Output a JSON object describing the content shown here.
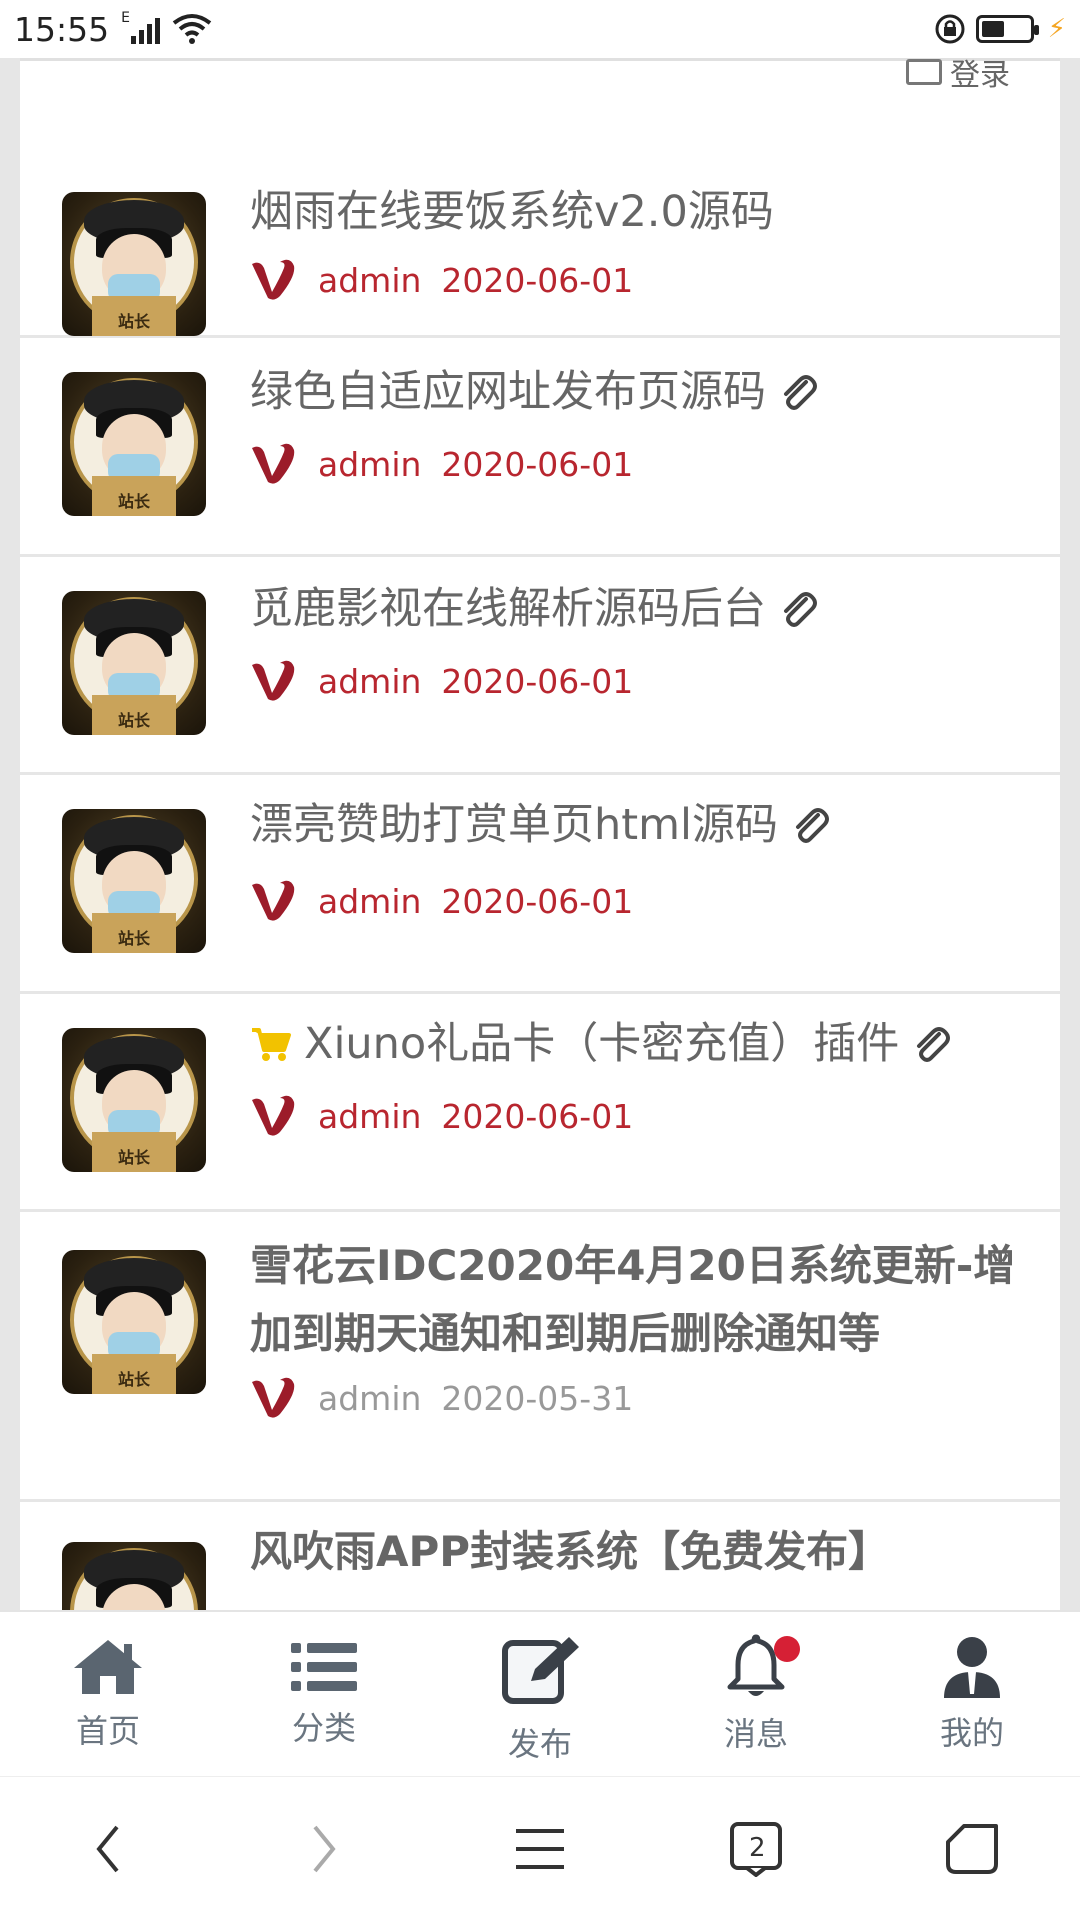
{
  "status": {
    "time": "15:55",
    "signal_label": "E",
    "icons": [
      "signal-icon",
      "wifi-icon",
      "lock-rotation-icon",
      "battery-icon",
      "charging-icon"
    ]
  },
  "top_partial": {
    "label": "登录"
  },
  "posts": [
    {
      "title": "烟雨在线要饭系统v2.0源码",
      "author": "admin",
      "date": "2020-06-01",
      "attachment": false,
      "cart": false,
      "bold": false,
      "highlight": true,
      "avatar_text": "站长"
    },
    {
      "title": "绿色自适应网址发布页源码",
      "author": "admin",
      "date": "2020-06-01",
      "attachment": true,
      "cart": false,
      "bold": false,
      "highlight": true,
      "avatar_text": "站长"
    },
    {
      "title": "觅鹿影视在线解析源码后台",
      "author": "admin",
      "date": "2020-06-01",
      "attachment": true,
      "cart": false,
      "bold": false,
      "highlight": true,
      "avatar_text": "站长"
    },
    {
      "title": "漂亮赞助打赏单页html源码",
      "author": "admin",
      "date": "2020-06-01",
      "attachment": true,
      "cart": false,
      "bold": false,
      "highlight": true,
      "avatar_text": "站长"
    },
    {
      "title": "Xiuno礼品卡（卡密充值）插件",
      "author": "admin",
      "date": "2020-06-01",
      "attachment": true,
      "cart": true,
      "bold": false,
      "highlight": true,
      "avatar_text": "站长"
    },
    {
      "title": "雪花云IDC2020年4月20日系统更新-增加到期天通知和到期后删除通知等",
      "author": "admin",
      "date": "2020-05-31",
      "attachment": false,
      "cart": false,
      "bold": true,
      "highlight": false,
      "avatar_text": "站长"
    },
    {
      "title": "风吹雨APP封装系统【免费发布】",
      "author": "",
      "date": "",
      "attachment": false,
      "cart": false,
      "bold": true,
      "highlight": false,
      "avatar_text": ""
    }
  ],
  "tabbar": {
    "home": "首页",
    "category": "分类",
    "publish": "发布",
    "messages": "消息",
    "mine": "我的",
    "message_badge": true
  },
  "navbar": {
    "icons": [
      "back-icon",
      "forward-icon",
      "menu-icon",
      "tabs-icon",
      "home-icon"
    ],
    "tabs_count": "2"
  },
  "colors": {
    "accent_red": "#b8262f",
    "title_grey": "#666666",
    "badge_red": "#d62035",
    "cart_yellow": "#f2c200"
  }
}
